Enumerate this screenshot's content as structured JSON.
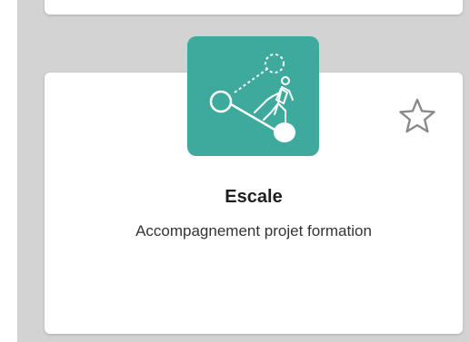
{
  "app_card": {
    "title": "Escale",
    "subtitle": "Accompagnement projet formation",
    "icon": "escale-climber-icon",
    "icon_bg_color": "#3ea99d",
    "favorite_icon": "star-outline-icon"
  },
  "colors": {
    "page_background": "#d3d3d3",
    "card_background": "#ffffff",
    "title_text": "#1f1f1f",
    "subtitle_text": "#333333",
    "star_outline": "#8a8a8a"
  }
}
